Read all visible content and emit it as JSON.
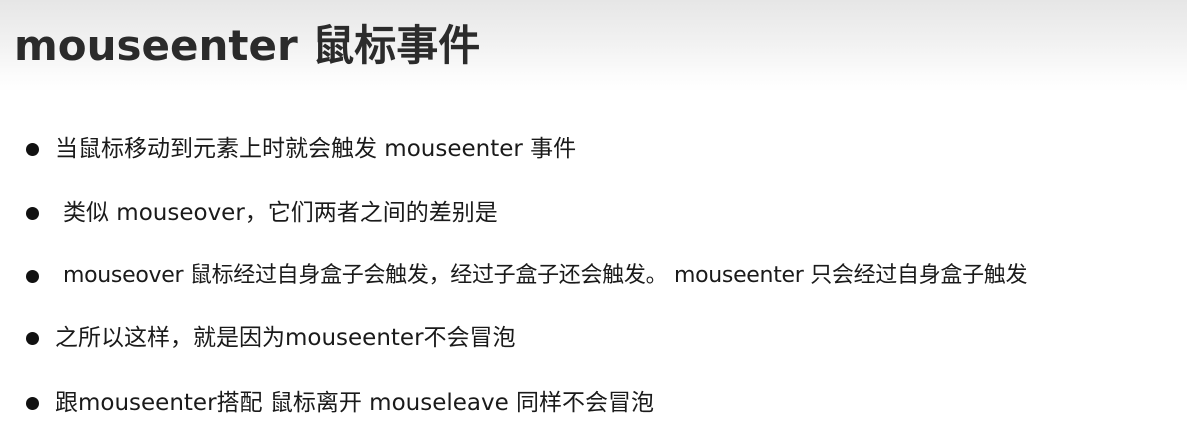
{
  "slide": {
    "title": "mouseenter 鼠标事件",
    "bullets": [
      "当鼠标移动到元素上时就会触发 mouseenter 事件",
      "类似 mouseover，它们两者之间的差别是",
      "mouseover 鼠标经过自身盒子会触发，经过子盒子还会触发。 mouseenter  只会经过自身盒子触发",
      "之所以这样，就是因为mouseenter不会冒泡",
      "跟mouseenter搭配 鼠标离开 mouseleave  同样不会冒泡"
    ]
  }
}
